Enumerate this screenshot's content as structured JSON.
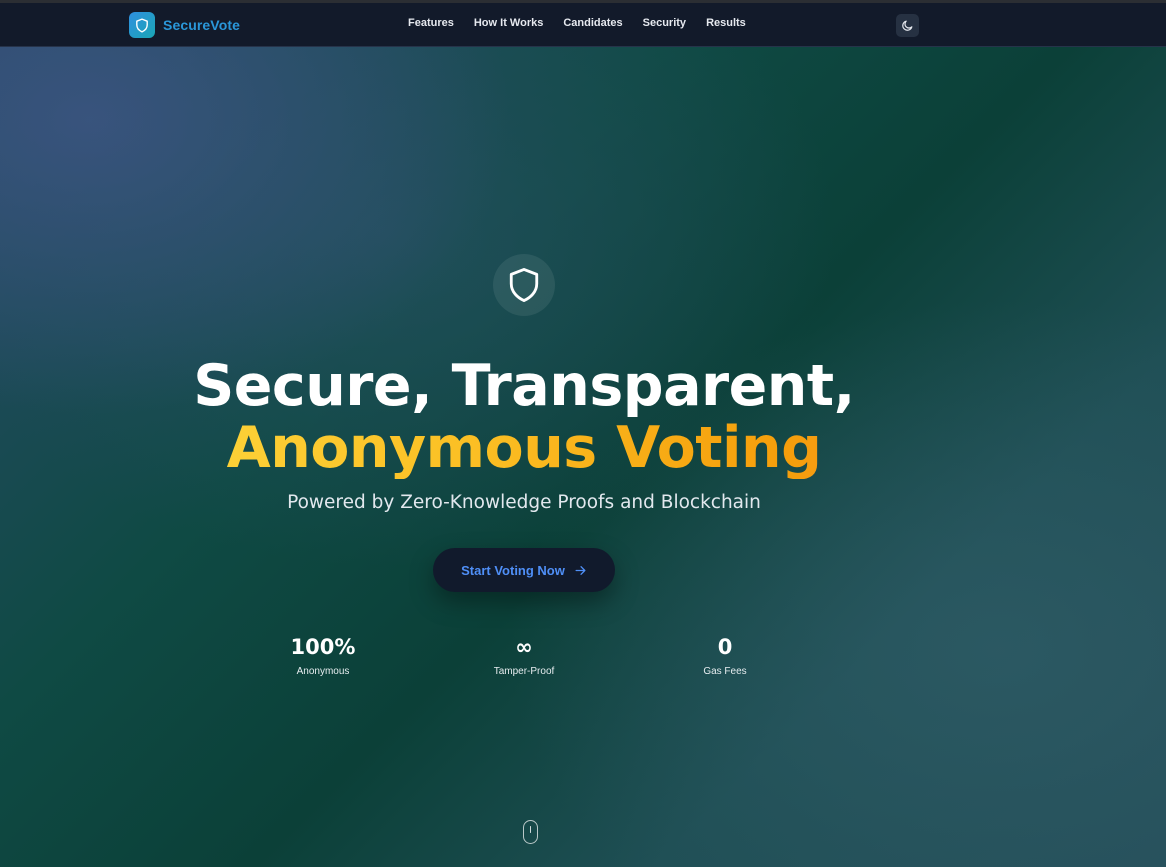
{
  "app": {
    "brand_name": "SecureVote",
    "brand_icon": "shield-icon",
    "accent_color": "#2a97d9"
  },
  "nav": {
    "links": [
      {
        "label": "Features"
      },
      {
        "label": "How It Works"
      },
      {
        "label": "Candidates"
      },
      {
        "label": "Security"
      },
      {
        "label": "Results"
      }
    ],
    "theme_toggle_icon": "moon-icon"
  },
  "hero": {
    "icon": "shield-icon",
    "title_line1": "Secure, Transparent,",
    "title_line2": "Anonymous Voting",
    "subtitle": "Powered by Zero-Knowledge Proofs and Blockchain",
    "cta_label": "Start Voting Now",
    "cta_icon": "arrow-right-icon",
    "highlight_gradient": [
      "#fde047",
      "#fb923c"
    ]
  },
  "stats": [
    {
      "value": "100%",
      "label": "Anonymous"
    },
    {
      "value": "∞",
      "label": "Tamper-Proof"
    },
    {
      "value": "0",
      "label": "Gas Fees"
    }
  ],
  "scroll_indicator_icon": "mouse-scroll-icon"
}
